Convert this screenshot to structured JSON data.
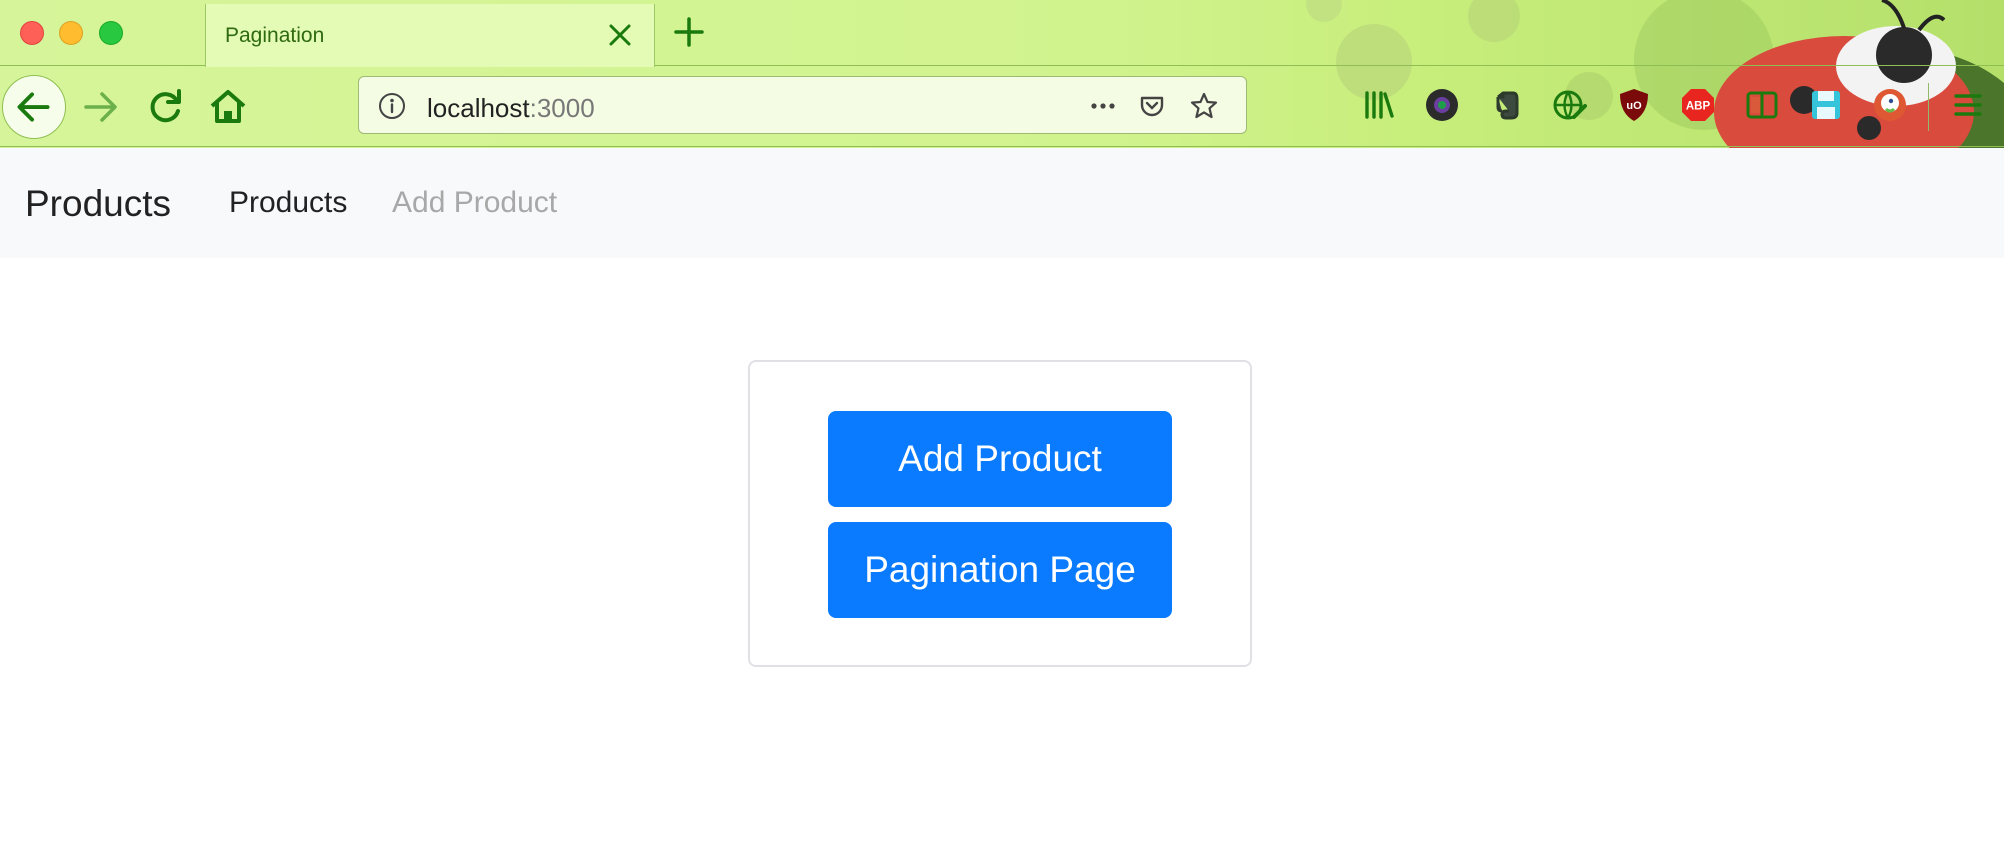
{
  "browser": {
    "tab_title": "Pagination",
    "url_host": "localhost",
    "url_port": ":3000",
    "icons": [
      "back-icon",
      "forward-icon",
      "reload-icon",
      "home-icon",
      "info-icon",
      "more-icon",
      "pocket-icon",
      "bookmark-star-icon",
      "library-icon",
      "camera-extension-icon",
      "evernote-icon",
      "translate-extension-icon",
      "ublock-icon",
      "adblock-plus-icon",
      "reader-extension-icon",
      "save-extension-icon",
      "duckduckgo-icon",
      "menu-icon"
    ],
    "colors": {
      "icon_green": "#1a7a0e",
      "theme_bg": "#d1f38e"
    }
  },
  "navbar": {
    "brand": "Products",
    "links": [
      {
        "label": "Products",
        "active": true
      },
      {
        "label": "Add Product",
        "active": false
      }
    ]
  },
  "main": {
    "buttons": [
      {
        "label": "Add Product"
      },
      {
        "label": "Pagination Page"
      }
    ],
    "colors": {
      "primary": "#0a7bff",
      "navbar_bg": "#f8f9fa"
    }
  },
  "theme_badges": {
    "ublock": "uO",
    "abp": "ABP"
  }
}
